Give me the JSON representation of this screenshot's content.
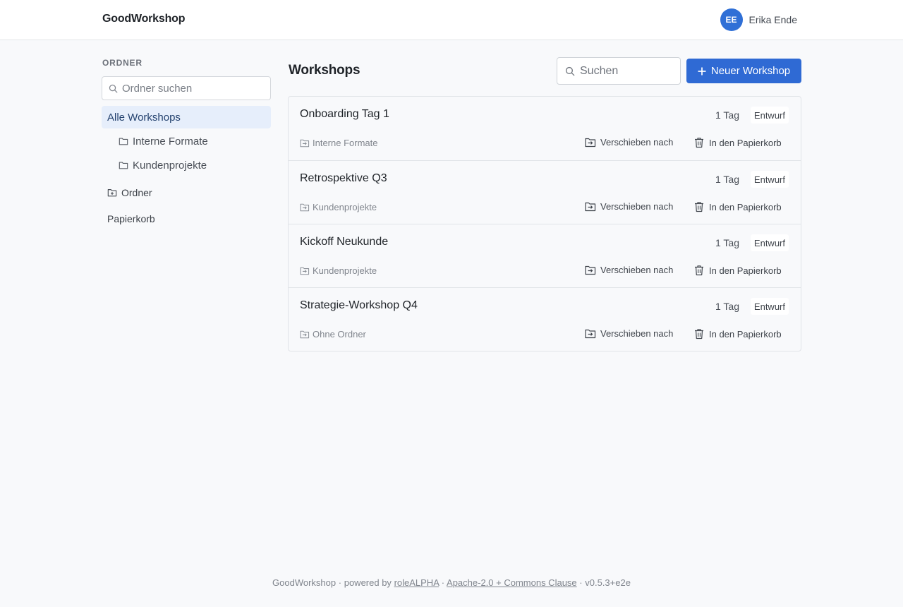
{
  "header": {
    "brand": "GoodWorkshop",
    "user": {
      "initials": "EE",
      "name": "Erika Ende"
    }
  },
  "sidebar": {
    "heading": "ORDNER",
    "search_placeholder": "Ordner suchen",
    "all_label": "Alle Workshops",
    "folders": [
      "Interne Formate",
      "Kundenprojekte"
    ],
    "folder_label": "Ordner",
    "trash_label": "Papierkorb"
  },
  "main": {
    "title": "Workshops",
    "search_placeholder": "Suchen",
    "new_button": "Neuer Workshop",
    "workshops": [
      {
        "title": "Onboarding Tag 1",
        "duration": "1 Tag",
        "status": "Entwurf",
        "folder": "Interne Formate",
        "move": "Verschieben nach",
        "trash": "In den Papierkorb"
      },
      {
        "title": "Retrospektive Q3",
        "duration": "1 Tag",
        "status": "Entwurf",
        "folder": "Kundenprojekte",
        "move": "Verschieben nach",
        "trash": "In den Papierkorb"
      },
      {
        "title": "Kickoff Neukunde",
        "duration": "1 Tag",
        "status": "Entwurf",
        "folder": "Kundenprojekte",
        "move": "Verschieben nach",
        "trash": "In den Papierkorb"
      },
      {
        "title": "Strategie-Workshop Q4",
        "duration": "1 Tag",
        "status": "Entwurf",
        "folder": "Ohne Ordner",
        "move": "Verschieben nach",
        "trash": "In den Papierkorb"
      }
    ]
  },
  "footer": {
    "product": "GoodWorkshop",
    "sep": "·",
    "powered_by": "powered by",
    "company": "roleALPHA",
    "license": "Apache-2.0 + Commons Clause",
    "version": "v0.5.3+e2e"
  },
  "colors": {
    "accent": "#2f6ad4",
    "selected_bg": "#e6eefb",
    "background": "#f8f9fb"
  },
  "icons": {
    "search": "search-icon",
    "folder": "folder-icon",
    "folder_add": "folder-plus-icon",
    "move": "folder-move-icon",
    "trash": "trash-icon",
    "plus": "plus-icon"
  }
}
